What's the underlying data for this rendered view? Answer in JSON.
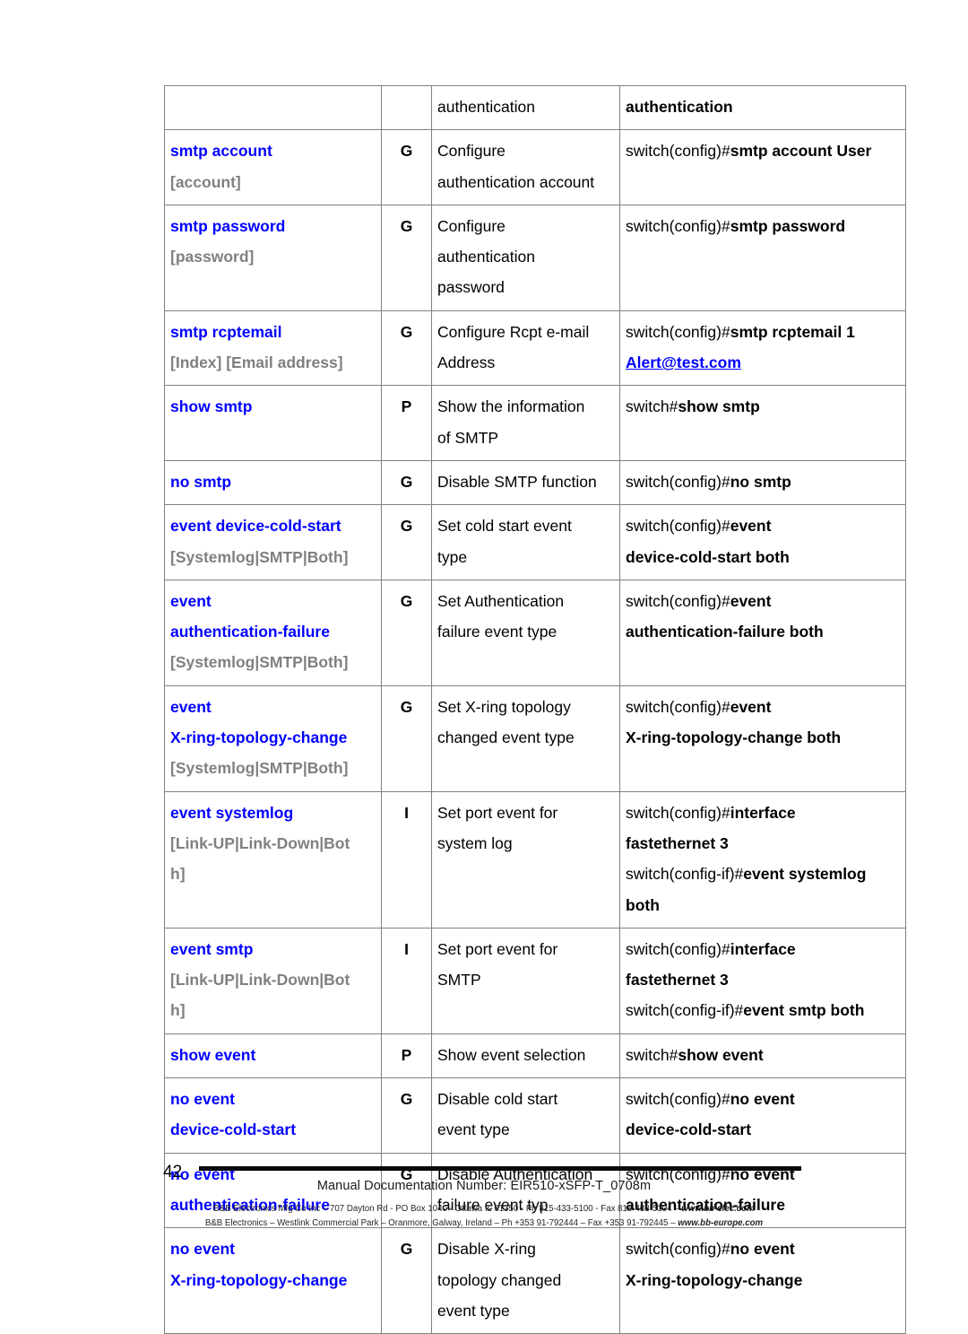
{
  "document": {
    "page_number": "42",
    "footer_doc_number": "Manual Documentation Number: EIR510-xSFP-T_0708m",
    "footer_address_line1_pre": "B&B Electronics Mfg Co Inc – 707 Dayton Rd - PO Box 1040 - Ottawa IL 61350 - Ph 815-433-5100 - Fax 815-433-5104 – ",
    "footer_address_line1_url": "www.bb-elec.com",
    "footer_address_line2_pre": "B&B Electronics – Westlink Commercial Park – Oranmore, Galway, Ireland – Ph +353 91-792444 – Fax +353 91-792445 – ",
    "footer_address_line2_url": "www.bb-europe.com"
  },
  "table": {
    "rows": [
      {
        "command": "",
        "argument": "",
        "mode": "",
        "description": [
          "authentication"
        ],
        "example": [
          {
            "prompt": "",
            "bold": "authentication"
          }
        ]
      },
      {
        "command": "smtp account",
        "argument": "[account]",
        "mode": "G",
        "description": [
          "Configure",
          "authentication account"
        ],
        "example": [
          {
            "prompt": "switch(config)#",
            "bold": "smtp account User"
          }
        ]
      },
      {
        "command": "smtp password",
        "argument": "[password]",
        "mode": "G",
        "description": [
          "Configure",
          "authentication",
          "password"
        ],
        "example": [
          {
            "prompt": "switch(config)#",
            "bold": "smtp password"
          }
        ]
      },
      {
        "command": "smtp rcptemail",
        "argument": "[Index] [Email address]",
        "mode": "G",
        "description": [
          "Configure Rcpt e-mail",
          "Address"
        ],
        "example": [
          {
            "prompt": "switch(config)#",
            "bold": "smtp rcptemail 1"
          },
          {
            "link": "Alert@test.com"
          }
        ]
      },
      {
        "command": "show smtp",
        "argument": "",
        "mode": "P",
        "description": [
          "Show the information",
          "of SMTP"
        ],
        "example": [
          {
            "prompt": "switch#",
            "bold": "show smtp"
          }
        ]
      },
      {
        "command": "no smtp",
        "argument": "",
        "mode": "G",
        "description": [
          "Disable SMTP function"
        ],
        "example": [
          {
            "prompt": "switch(config)#",
            "bold": "no smtp"
          }
        ]
      },
      {
        "command": "event device-cold-start",
        "argument": "[Systemlog|SMTP|Both]",
        "mode": "G",
        "description": [
          "Set cold start event",
          "type"
        ],
        "example": [
          {
            "prompt": "switch(config)#",
            "bold": "event"
          },
          {
            "prompt": "",
            "bold": "device-cold-start both"
          }
        ]
      },
      {
        "command": "event",
        "command2": "authentication-failure",
        "argument": "[Systemlog|SMTP|Both]",
        "mode": "G",
        "description": [
          "Set Authentication",
          "failure event type"
        ],
        "example": [
          {
            "prompt": "switch(config)#",
            "bold": "event"
          },
          {
            "prompt": "",
            "bold": "authentication-failure both"
          }
        ]
      },
      {
        "command": "event",
        "command2": "X-ring-topology-change",
        "argument": "[Systemlog|SMTP|Both]",
        "mode": "G",
        "description": [
          "Set X-ring topology",
          "changed event type"
        ],
        "example": [
          {
            "prompt": "switch(config)#",
            "bold": "event"
          },
          {
            "prompt": "",
            "bold": "X-ring-topology-change both"
          }
        ]
      },
      {
        "command": "event systemlog",
        "argument": "[Link-UP|Link-Down|Bot",
        "argument2": "h]",
        "mode": "I",
        "description": [
          "Set port event for",
          "system log"
        ],
        "example": [
          {
            "prompt": "switch(config)#",
            "bold": "interface"
          },
          {
            "prompt": "",
            "bold": "fastethernet 3"
          },
          {
            "prompt": "switch(config-if)#",
            "bold": "event systemlog"
          },
          {
            "prompt": "",
            "bold": "both"
          }
        ]
      },
      {
        "command": "event smtp",
        "argument": "[Link-UP|Link-Down|Bot",
        "argument2": "h]",
        "mode": "I",
        "description": [
          "Set port event for",
          "SMTP"
        ],
        "example": [
          {
            "prompt": "switch(config)#",
            "bold": "interface"
          },
          {
            "prompt": "",
            "bold": "fastethernet 3"
          },
          {
            "prompt": "switch(config-if)#",
            "bold": "event smtp both"
          }
        ]
      },
      {
        "command": "show event",
        "argument": "",
        "mode": "P",
        "description": [
          "Show event selection"
        ],
        "example": [
          {
            "prompt": "switch#",
            "bold": "show event"
          }
        ]
      },
      {
        "command": "no event",
        "command2": "device-cold-start",
        "argument": "",
        "mode": "G",
        "description": [
          "Disable cold start",
          "event type"
        ],
        "example": [
          {
            "prompt": "switch(config)#",
            "bold": "no event"
          },
          {
            "prompt": "",
            "bold": "device-cold-start"
          }
        ]
      },
      {
        "command": "no event",
        "command2": "authentication-failure",
        "argument": "",
        "mode": "G",
        "description": [
          "Disable Authentication",
          "failure event typ"
        ],
        "example": [
          {
            "prompt": "switch(config)#",
            "bold": "no event"
          },
          {
            "prompt": "",
            "bold": "authentication-failure"
          }
        ]
      },
      {
        "command": "no event",
        "command2": "X-ring-topology-change",
        "argument": "",
        "mode": "G",
        "description": [
          "Disable X-ring",
          "topology changed",
          "event type"
        ],
        "example": [
          {
            "prompt": "switch(config)#",
            "bold": "no event"
          },
          {
            "prompt": "",
            "bold": "X-ring-topology-change"
          }
        ]
      }
    ]
  }
}
